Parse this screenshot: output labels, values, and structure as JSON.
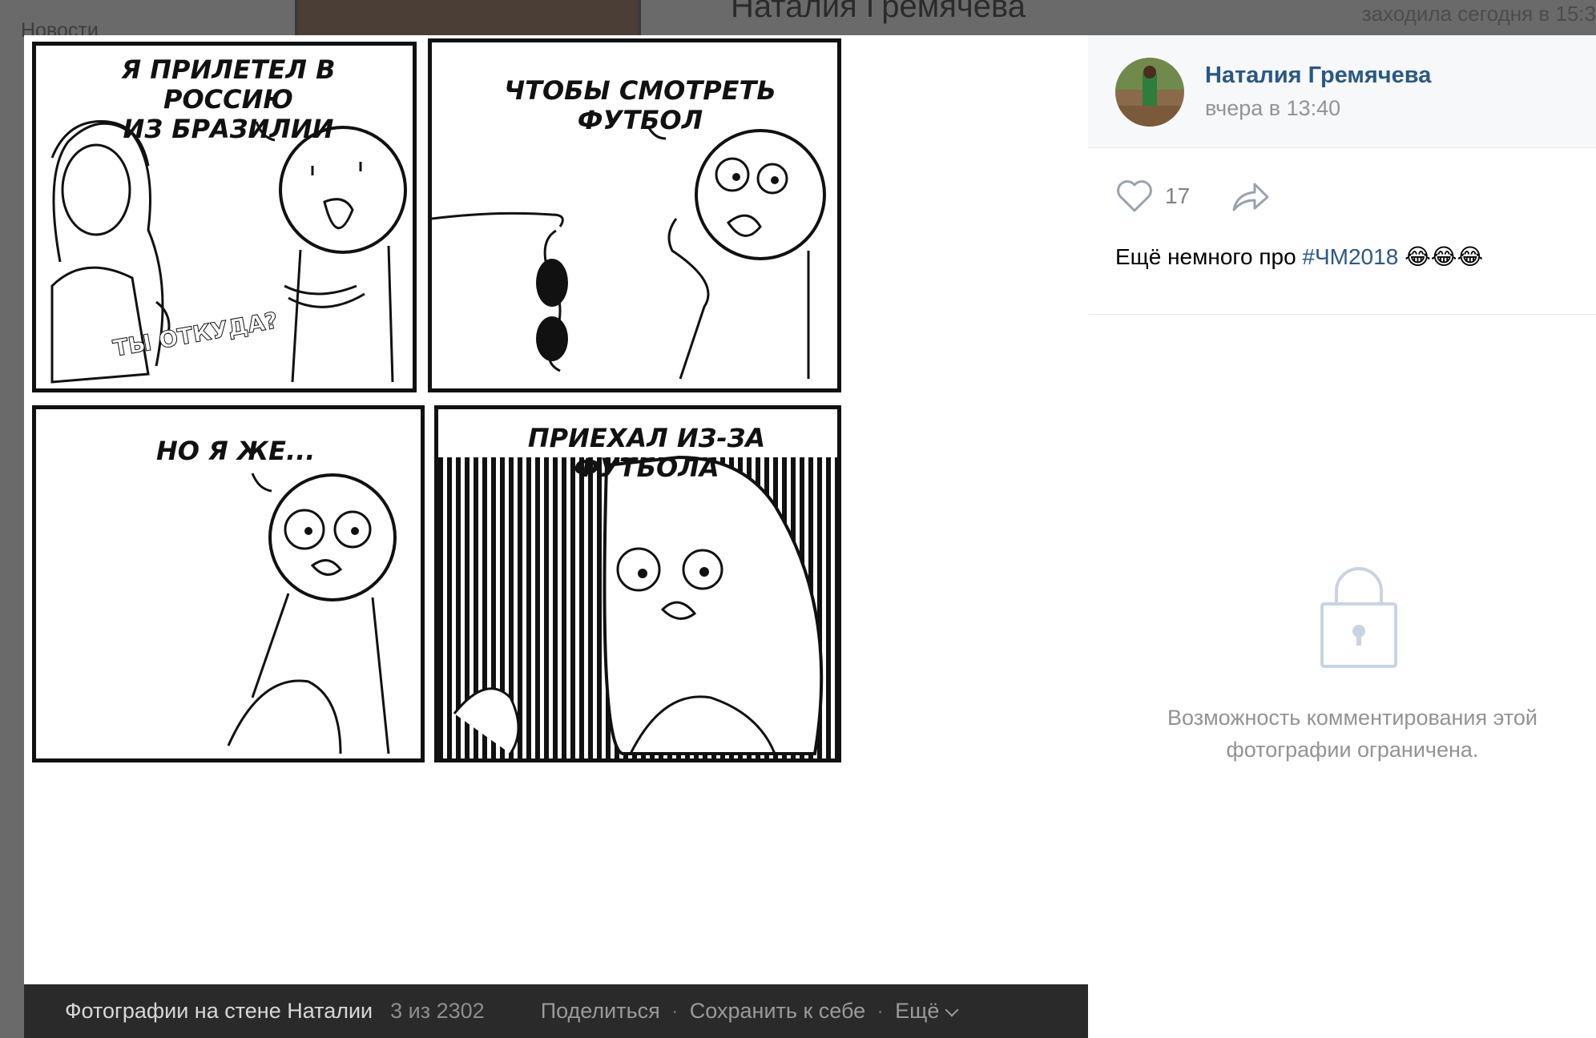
{
  "background": {
    "nav_news": "Новости",
    "profile_name": "Наталия Гремячева",
    "last_seen": "заходила сегодня в 15:3"
  },
  "comic": {
    "panel1_text": "Я ПРИЛЕТЕЛ В РОССИЮ\nИЗ БРАЗИЛИИ",
    "panel1_question": "ТЫ ОТКУДА?",
    "panel2_text": "ЧТОБЫ СМОТРЕТЬ ФУТБОЛ",
    "panel3_text": "НО Я ЖЕ...",
    "panel4_text": "ПРИЕХАЛ ИЗ-ЗА ФУТБОЛА"
  },
  "footer": {
    "album_title": "Фотографии на стене Наталии",
    "counter": "3 из 2302",
    "share": "Поделиться",
    "separator": "·",
    "save": "Сохранить к себе",
    "more": "Ещё"
  },
  "post": {
    "author": "Наталия Гремячева",
    "time": "вчера в 13:40",
    "likes": "17",
    "text_prefix": "Ещё немного про ",
    "hashtag": "#ЧМ2018",
    "emoji": "😂😂😂"
  },
  "comments": {
    "restricted_message": "Возможность комментирования этой фотографии ограничена."
  },
  "colors": {
    "link": "#2a5885",
    "muted": "#939393",
    "footer_bg": "#2a2a2a"
  },
  "icons": [
    "heart-icon",
    "share-arrow-icon",
    "lock-icon",
    "chevron-down-icon"
  ]
}
